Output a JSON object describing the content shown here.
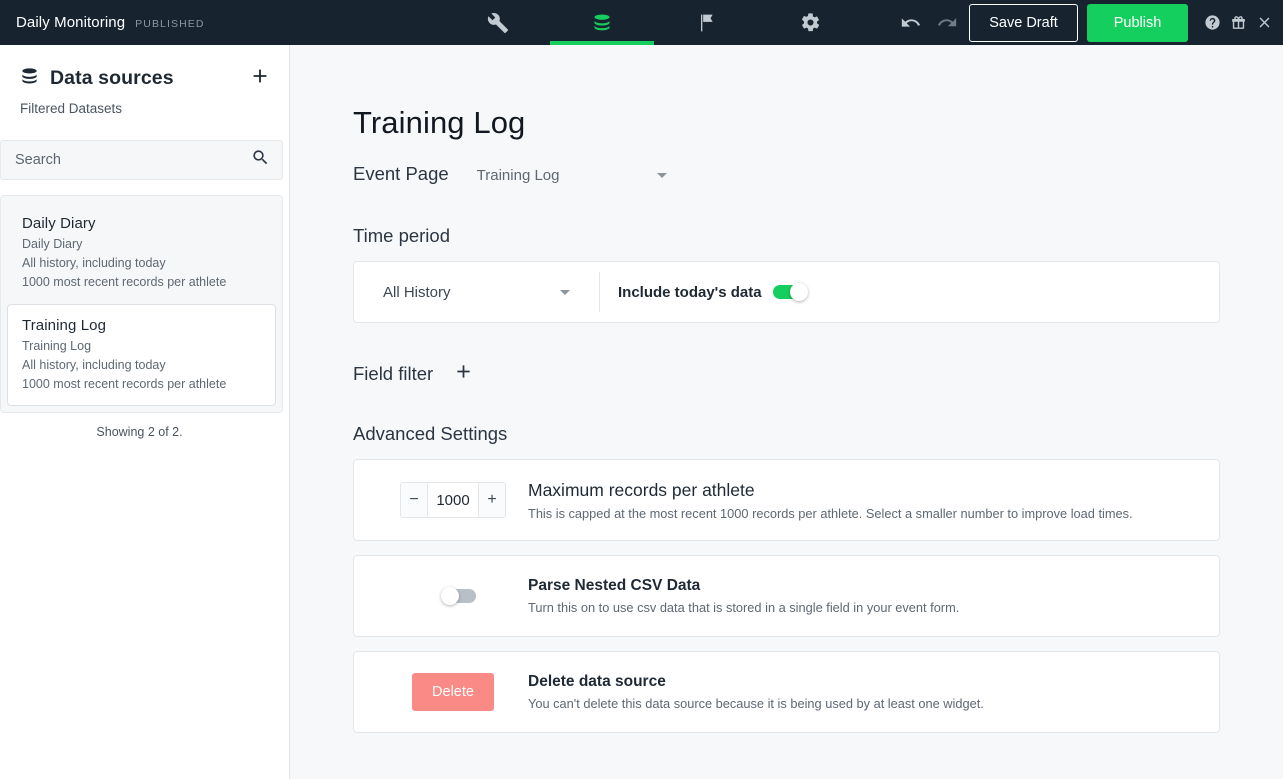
{
  "topbar": {
    "brand_title": "Daily Monitoring",
    "brand_status": "PUBLISHED",
    "tabs": [
      {
        "icon": "wrench-icon",
        "name": "build",
        "active": false
      },
      {
        "icon": "database-icon",
        "name": "data-sources",
        "active": true
      },
      {
        "icon": "flag-icon",
        "name": "flags",
        "active": false
      },
      {
        "icon": "gear-icon",
        "name": "settings",
        "active": false
      }
    ],
    "undo_label": "undo-icon",
    "redo_label": "redo-icon",
    "save_draft_label": "Save Draft",
    "publish_label": "Publish",
    "help_icon": "help-icon",
    "gift_icon": "gift-icon",
    "close_icon": "close-icon",
    "accent_green": "#14CF5E",
    "bar_background": "#17232F"
  },
  "sidebar": {
    "title": "Data sources",
    "db_icon": "database-icon",
    "add_icon": "plus-icon",
    "subtitle": "Filtered Datasets",
    "search": {
      "placeholder": "Search",
      "value": "",
      "icon": "search-icon"
    },
    "items": [
      {
        "title": "Daily Diary",
        "source": "Daily Diary",
        "history": "All history, including today",
        "records": "1000 most recent records per athlete",
        "selected": false
      },
      {
        "title": "Training Log",
        "source": "Training Log",
        "history": "All history, including today",
        "records": "1000 most recent records per athlete",
        "selected": true
      }
    ],
    "count_label": "Showing 2 of 2."
  },
  "main": {
    "page_title": "Training Log",
    "event_page": {
      "label": "Event Page",
      "selected": "Training Log"
    },
    "time_period": {
      "heading": "Time period",
      "range_selected": "All History",
      "include_today_label": "Include today's data",
      "include_today_on": true
    },
    "field_filter": {
      "label": "Field filter",
      "add_icon": "plus-icon"
    },
    "advanced": {
      "heading": "Advanced Settings",
      "max_records": {
        "minus_label": "−",
        "plus_label": "+",
        "value": "1000",
        "title": "Maximum records per athlete",
        "description": "This is capped at the most recent 1000 records per athlete. Select a smaller number to improve load times."
      },
      "parse_csv": {
        "title": "Parse Nested CSV Data",
        "description": "Turn this on to use csv data that is stored in a single field in your event form.",
        "enabled": false
      },
      "delete": {
        "button_label": "Delete",
        "title": "Delete data source",
        "description": "You can't delete this data source because it is being used by at least one widget.",
        "button_color": "#F98A85"
      }
    }
  }
}
